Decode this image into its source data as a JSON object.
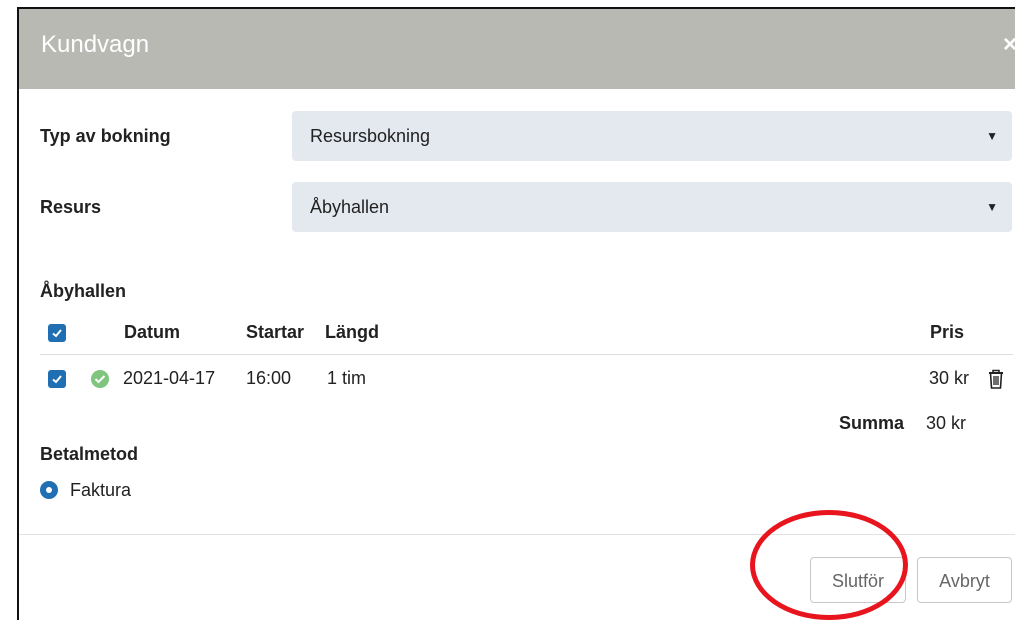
{
  "dialog": {
    "title": "Kundvagn",
    "close_icon": "×"
  },
  "form": {
    "booking_type_label": "Typ av bokning",
    "booking_type_value": "Resursbokning",
    "resource_label": "Resurs",
    "resource_value": "Åbyhallen"
  },
  "section": {
    "title": "Åbyhallen"
  },
  "table": {
    "headers": {
      "date": "Datum",
      "start": "Startar",
      "length": "Längd",
      "price": "Pris"
    },
    "rows": [
      {
        "date": "2021-04-17",
        "start": "16:00",
        "length": "1 tim",
        "price": "30 kr",
        "checked": true
      }
    ],
    "sum_label": "Summa",
    "sum_value": "30 kr"
  },
  "payment": {
    "label": "Betalmetod",
    "option": "Faktura"
  },
  "footer": {
    "finish_label": "Slutför",
    "cancel_label": "Avbryt"
  },
  "colors": {
    "header_bg": "#b9b9b4",
    "accent": "#1f6fb2",
    "select_bg": "#e4e8ef",
    "annotation": "#e8141e"
  }
}
